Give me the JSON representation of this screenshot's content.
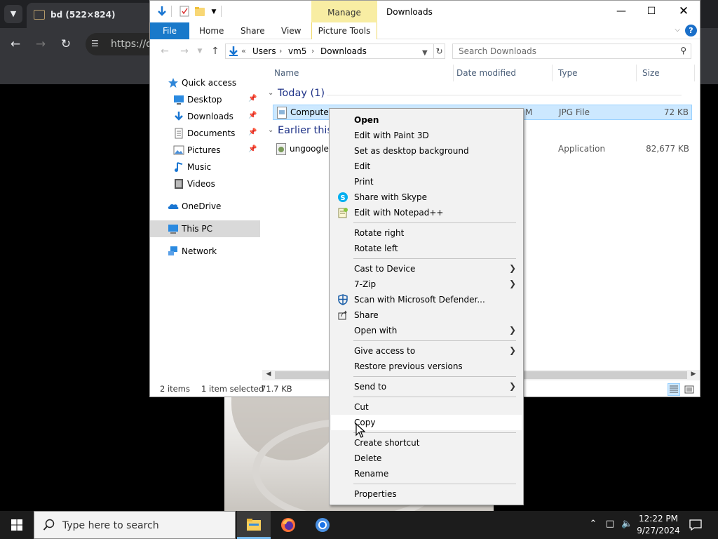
{
  "browser": {
    "tab_title": "bd (522×824)",
    "url_partial": "https://du"
  },
  "explorer": {
    "window_title": "Downloads",
    "ribbon": {
      "contextual_group": "Manage",
      "tabs": [
        "File",
        "Home",
        "Share",
        "View",
        "Picture Tools"
      ]
    },
    "address": {
      "overflow": "«",
      "segments": [
        "Users",
        "vm5",
        "Downloads"
      ]
    },
    "search_placeholder": "Search Downloads",
    "nav": [
      {
        "label": "Quick access",
        "icon": "star-icon"
      },
      {
        "label": "Desktop",
        "icon": "desktop-icon",
        "pinned": true
      },
      {
        "label": "Downloads",
        "icon": "download-icon",
        "pinned": true
      },
      {
        "label": "Documents",
        "icon": "document-icon",
        "pinned": true
      },
      {
        "label": "Pictures",
        "icon": "pictures-icon",
        "pinned": true
      },
      {
        "label": "Music",
        "icon": "music-icon"
      },
      {
        "label": "Videos",
        "icon": "videos-icon"
      },
      {
        "label": "OneDrive",
        "icon": "cloud-icon"
      },
      {
        "label": "This PC",
        "icon": "computer-icon",
        "selected": true
      },
      {
        "label": "Network",
        "icon": "network-icon"
      }
    ],
    "columns": [
      "Name",
      "Date modified",
      "Type",
      "Size"
    ],
    "groups": [
      {
        "label": "Today (1)",
        "files": [
          {
            "name": "Computer",
            "date_fragment": "M",
            "type": "JPG File",
            "size": "72 KB",
            "selected": true
          }
        ]
      },
      {
        "label": "Earlier this",
        "files": [
          {
            "name": "ungoogled",
            "type": "Application",
            "size": "82,677 KB",
            "selected": false
          }
        ]
      }
    ],
    "status": {
      "items": "2 items",
      "selection": "1 item selected",
      "size": "71.7 KB"
    }
  },
  "context_menu": {
    "items": [
      {
        "label": "Open",
        "bold": true
      },
      {
        "label": "Edit with Paint 3D"
      },
      {
        "label": "Set as desktop background"
      },
      {
        "label": "Edit"
      },
      {
        "label": "Print"
      },
      {
        "label": "Share with Skype",
        "icon": "skype-icon"
      },
      {
        "label": "Edit with Notepad++",
        "icon": "notepad-plus-plus-icon"
      },
      {
        "label": "Rotate right"
      },
      {
        "label": "Rotate left"
      },
      {
        "label": "Cast to Device",
        "submenu": true
      },
      {
        "label": "7-Zip",
        "submenu": true
      },
      {
        "label": "Scan with Microsoft Defender...",
        "icon": "defender-icon"
      },
      {
        "label": "Share",
        "icon": "share-icon"
      },
      {
        "label": "Open with",
        "submenu": true
      },
      {
        "label": "Give access to",
        "submenu": true
      },
      {
        "label": "Restore previous versions"
      },
      {
        "label": "Send to",
        "submenu": true
      },
      {
        "label": "Cut"
      },
      {
        "label": "Copy",
        "hovered": true
      },
      {
        "label": "Create shortcut"
      },
      {
        "label": "Delete"
      },
      {
        "label": "Rename"
      },
      {
        "label": "Properties"
      }
    ]
  },
  "taskbar": {
    "search_placeholder": "Type here to search",
    "time": "12:22 PM",
    "date": "9/27/2024"
  },
  "colors": {
    "accent": "#1979ca",
    "selection": "#cce8ff",
    "manage_tab": "#f8eda3",
    "taskbar": "#1c1c1c"
  }
}
